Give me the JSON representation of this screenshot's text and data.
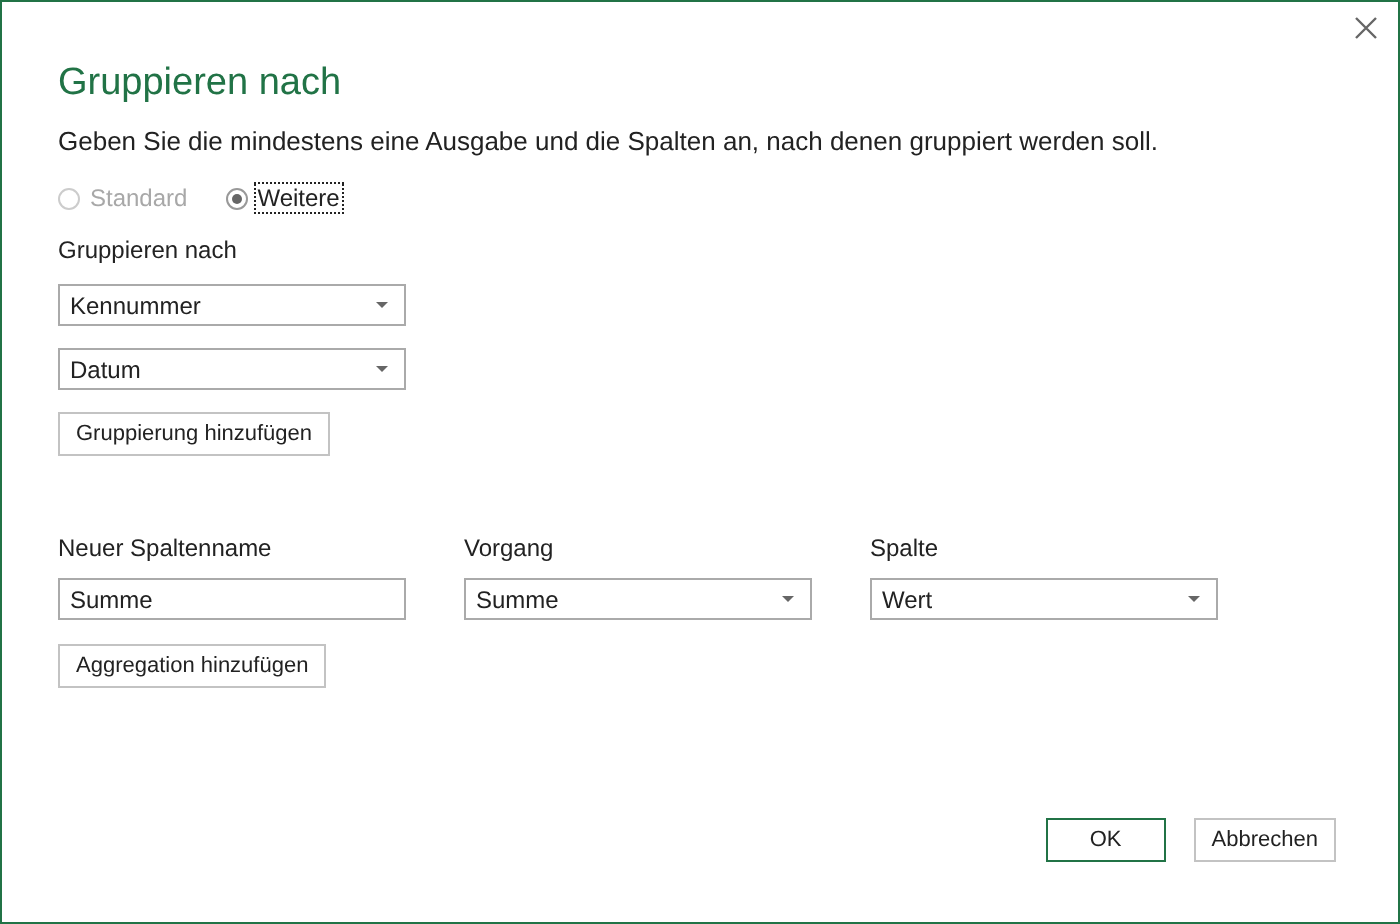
{
  "dialog": {
    "title": "Gruppieren nach",
    "description": "Geben Sie die mindestens eine Ausgabe und die Spalten an, nach denen gruppiert werden soll.",
    "modes": [
      {
        "label": "Standard",
        "selected": false,
        "disabled": true,
        "focused": false
      },
      {
        "label": "Weitere",
        "selected": true,
        "disabled": false,
        "focused": true
      }
    ],
    "group_by": {
      "label": "Gruppieren nach",
      "fields": [
        {
          "value": "Kennummer"
        },
        {
          "value": "Datum"
        }
      ],
      "add_button": "Gruppierung hinzufügen"
    },
    "aggregation": {
      "columns": [
        {
          "kind": "text",
          "label": "Neuer Spaltenname",
          "value": "Summe"
        },
        {
          "kind": "select",
          "label": "Vorgang",
          "value": "Summe"
        },
        {
          "kind": "select",
          "label": "Spalte",
          "value": "Wert"
        }
      ],
      "add_button": "Aggregation hinzufügen"
    },
    "buttons": [
      {
        "label": "OK",
        "primary": true
      },
      {
        "label": "Abbrechen",
        "primary": false
      }
    ]
  }
}
